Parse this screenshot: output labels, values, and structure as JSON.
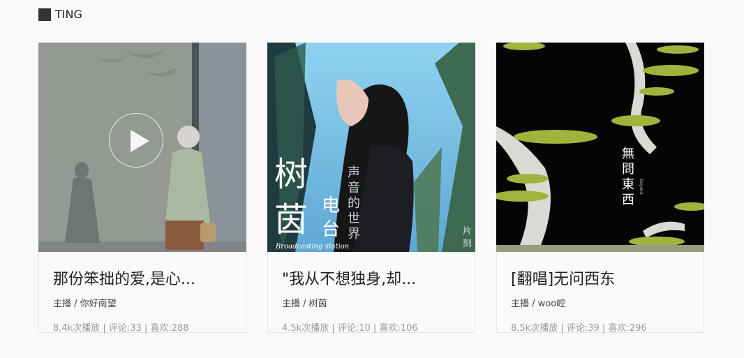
{
  "section": {
    "title": "TING"
  },
  "cards": [
    {
      "title": "那份笨拙的爱,是心...",
      "host_label": "主播 / 你好南望",
      "stats": "8.4k次播放 | 评论:33 | 喜欢:288"
    },
    {
      "title": "\"我从不想独身,却...",
      "host_label": "主播 / 树茵",
      "stats": "4.5k次播放 | 评论:10 | 喜欢:106",
      "cover_text": {
        "big": "树茵",
        "mid": "电台",
        "vertical": "声音的世界",
        "station": "Broadcasting station",
        "corner": "片刻"
      }
    },
    {
      "title": "[翻唱]无问西东",
      "host_label": "主播 / woo崆",
      "stats": "8.5k次播放 | 评论:39 | 喜欢:296",
      "cover_text": {
        "vertical": "無問東西",
        "small": "Beyond"
      }
    }
  ],
  "colors": {
    "cover1_wall": "#8a9196",
    "cover2_sky": "#8fd3f0",
    "cover3_bg": "#050505",
    "tree_green": "#9fb43c"
  }
}
